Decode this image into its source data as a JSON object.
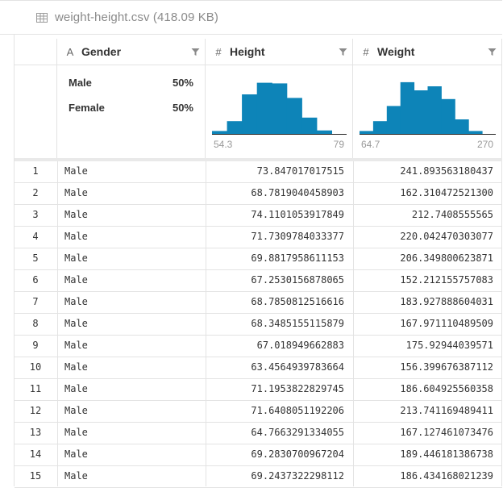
{
  "file": {
    "title": "weight-height.csv (418.09 KB)",
    "icon": "table-icon"
  },
  "columns": [
    {
      "name": "Gender",
      "type_icon": "A",
      "type": "string",
      "stats": [
        {
          "label": "Male",
          "pct": "50%"
        },
        {
          "label": "Female",
          "pct": "50%"
        }
      ]
    },
    {
      "name": "Height",
      "type_icon": "#",
      "type": "numeric",
      "range_min": "54.3",
      "range_max": "79",
      "histogram": [
        0.05,
        0.22,
        0.68,
        0.88,
        0.87,
        0.62,
        0.28,
        0.06,
        0.0
      ]
    },
    {
      "name": "Weight",
      "type_icon": "#",
      "type": "numeric",
      "range_min": "64.7",
      "range_max": "270",
      "histogram": [
        0.05,
        0.22,
        0.48,
        0.89,
        0.75,
        0.82,
        0.6,
        0.25,
        0.05,
        0.0
      ]
    }
  ],
  "colors": {
    "bar": "#0d84b8",
    "border": "#e3e3e3",
    "muted": "#8a8a8a"
  },
  "rows": [
    {
      "idx": "1",
      "gender": "Male",
      "height": "73.847017017515",
      "weight": "241.893563180437"
    },
    {
      "idx": "2",
      "gender": "Male",
      "height": "68.7819040458903",
      "weight": "162.310472521300"
    },
    {
      "idx": "3",
      "gender": "Male",
      "height": "74.1101053917849",
      "weight": "212.7408555565"
    },
    {
      "idx": "4",
      "gender": "Male",
      "height": "71.7309784033377",
      "weight": "220.042470303077"
    },
    {
      "idx": "5",
      "gender": "Male",
      "height": "69.8817958611153",
      "weight": "206.349800623871"
    },
    {
      "idx": "6",
      "gender": "Male",
      "height": "67.2530156878065",
      "weight": "152.212155757083"
    },
    {
      "idx": "7",
      "gender": "Male",
      "height": "68.7850812516616",
      "weight": "183.927888604031"
    },
    {
      "idx": "8",
      "gender": "Male",
      "height": "68.3485155115879",
      "weight": "167.971110489509"
    },
    {
      "idx": "9",
      "gender": "Male",
      "height": "67.018949662883",
      "weight": "175.92944039571"
    },
    {
      "idx": "10",
      "gender": "Male",
      "height": "63.4564939783664",
      "weight": "156.399676387112"
    },
    {
      "idx": "11",
      "gender": "Male",
      "height": "71.1953822829745",
      "weight": "186.604925560358"
    },
    {
      "idx": "12",
      "gender": "Male",
      "height": "71.6408051192206",
      "weight": "213.741169489411"
    },
    {
      "idx": "13",
      "gender": "Male",
      "height": "64.7663291334055",
      "weight": "167.127461073476"
    },
    {
      "idx": "14",
      "gender": "Male",
      "height": "69.2830700967204",
      "weight": "189.446181386738"
    },
    {
      "idx": "15",
      "gender": "Male",
      "height": "69.2437322298112",
      "weight": "186.434168021239"
    }
  ]
}
